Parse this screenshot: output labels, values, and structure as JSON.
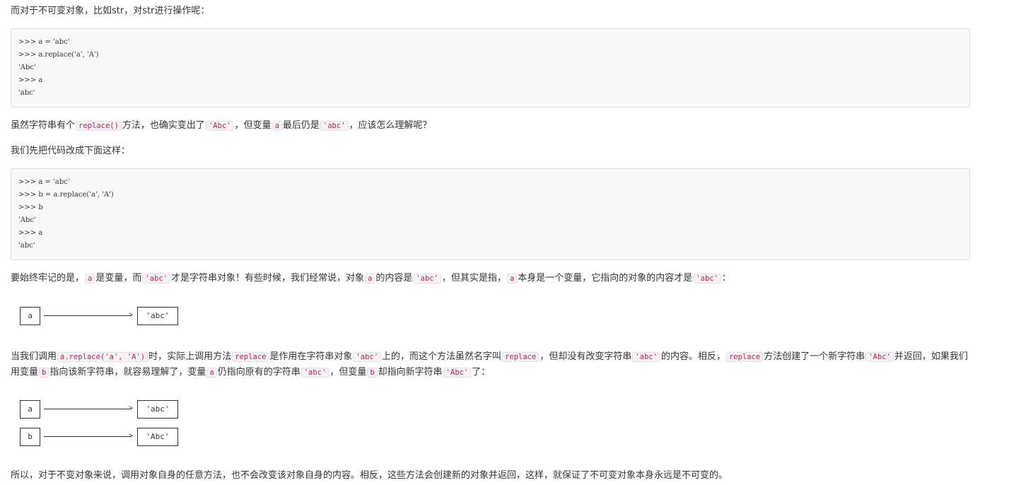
{
  "para1": "而对于不可变对象，比如str，对str进行操作呢：",
  "code1": [
    ">>> a = 'abc'",
    ">>> a.replace('a', 'A')",
    "'Abc'",
    ">>> a",
    "'abc'"
  ],
  "para2": {
    "t1": "虽然字符串有个",
    "c1": "replace()",
    "t2": "方法，也确实变出了",
    "c2": "'Abc'",
    "t3": "，但变量",
    "c3": "a",
    "t4": "最后仍是",
    "c4": "'abc'",
    "t5": "，应该怎么理解呢？"
  },
  "para3": "我们先把代码改成下面这样：",
  "code2": [
    ">>> a = 'abc'",
    ">>> b = a.replace('a', 'A')",
    ">>> b",
    "'Abc'",
    ">>> a",
    "'abc'"
  ],
  "para4": {
    "t1": "要始终牢记的是，",
    "c1": "a",
    "t2": "是变量，而",
    "c2": "'abc'",
    "t3": "才是字符串对象！有些时候，我们经常说，对象",
    "c3": "a",
    "t4": "的内容是",
    "c4": "'abc'",
    "t5": "，但其实是指，",
    "c5": "a",
    "t6": "本身是一个变量，它指向的对象的内容才是",
    "c6": "'abc'",
    "t7": "："
  },
  "diagram1": {
    "var": "a",
    "obj": "'abc'",
    "arrow": ">"
  },
  "para5": {
    "t1": "当我们调用",
    "c1": "a.replace('a', 'A')",
    "t2": "时，实际上调用方法",
    "c2": "replace",
    "t3": "是作用在字符串对象",
    "c3": "'abc'",
    "t4": "上的，而这个方法虽然名字叫",
    "c4": "replace",
    "t5": "，但却没有改变字符串",
    "c5": "'abc'",
    "t6": "的内容。相反，",
    "c6": "replace",
    "t7": "方法创建了一个新字符串",
    "c7": "'Abc'",
    "t8": "并返回，如果我们用变量",
    "c8": "b",
    "t9": "指向该新字符串，就容易理解了，变量",
    "c9": "a",
    "t10": "仍指向原有的字符串",
    "c10": "'abc'",
    "t11": "，但变量",
    "c11": "b",
    "t12": "却指向新字符串",
    "c12": "'Abc'",
    "t13": "了："
  },
  "diagram2": {
    "var": "a",
    "obj": "'abc'",
    "arrow": ">"
  },
  "diagram3": {
    "var": "b",
    "obj": "'Abc'",
    "arrow": ">"
  },
  "para6": "所以，对于不变对象来说，调用对象自身的任意方法，也不会改变该对象自身的内容。相反，这些方法会创建新的对象并返回，这样，就保证了不可变对象本身永远是不可变的。",
  "colors": {
    "inline_code": "#c7254e",
    "code_bg": "#f8f8f8",
    "text": "#333333"
  }
}
